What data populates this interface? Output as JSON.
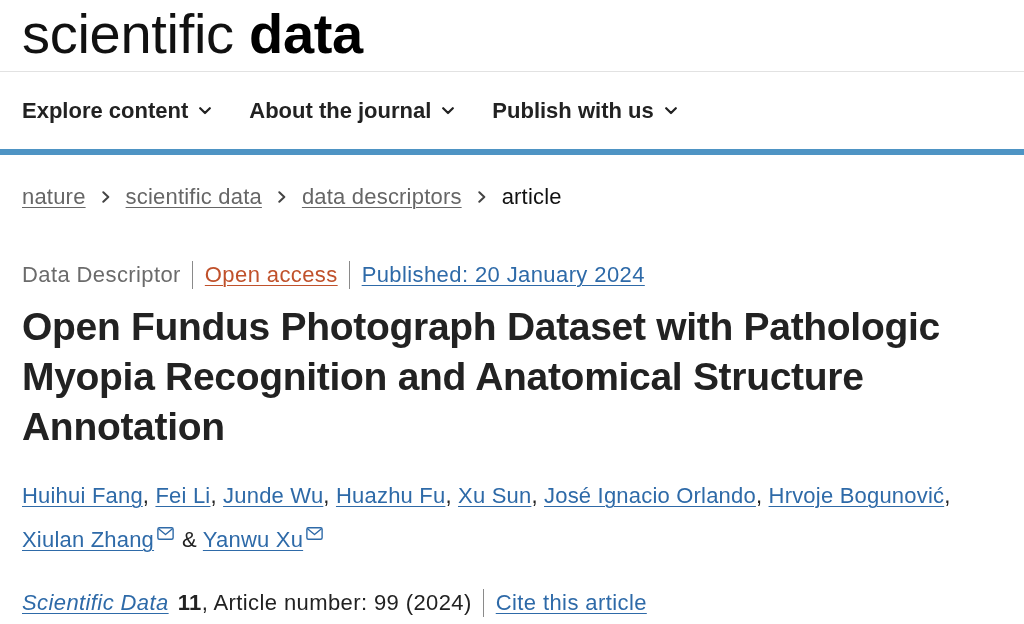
{
  "logo": "scientific **data**",
  "nav": [
    {
      "label": "Explore content"
    },
    {
      "label": "About the journal"
    },
    {
      "label": "Publish with us"
    }
  ],
  "breadcrumbs": [
    {
      "label": "nature",
      "kind": "link"
    },
    {
      "label": "scientific data",
      "kind": "link"
    },
    {
      "label": "data descriptors",
      "kind": "link"
    },
    {
      "label": "article",
      "kind": "current"
    }
  ],
  "article": {
    "article_type": "Data Descriptor",
    "access": "Open access",
    "published": "Published: 20 January 2024",
    "title": "Open Fundus Photograph Dataset with Pathologic Myopia Recognition and Anatomical Structure Annotation",
    "authors": [
      {
        "name": "Huihui Fang",
        "email": false,
        "separator": ","
      },
      {
        "name": "Fei Li",
        "email": false,
        "separator": ","
      },
      {
        "name": "Junde Wu",
        "email": false,
        "separator": ","
      },
      {
        "name": "Huazhu Fu",
        "email": false,
        "separator": ","
      },
      {
        "name": "Xu Sun",
        "email": false,
        "separator": ","
      },
      {
        "name": "José Ignacio Orlando",
        "email": false,
        "separator": ","
      },
      {
        "name": "Hrvoje Bogunović",
        "email": false,
        "separator": ","
      },
      {
        "name": "Xiulan Zhang",
        "email": true,
        "separator": "&"
      },
      {
        "name": "Yanwu Xu",
        "email": true
      }
    ],
    "citation": {
      "journal": "Scientific Data",
      "details": "**11**, Article number: 99 (2024)",
      "cite_link": "Cite this article"
    }
  }
}
